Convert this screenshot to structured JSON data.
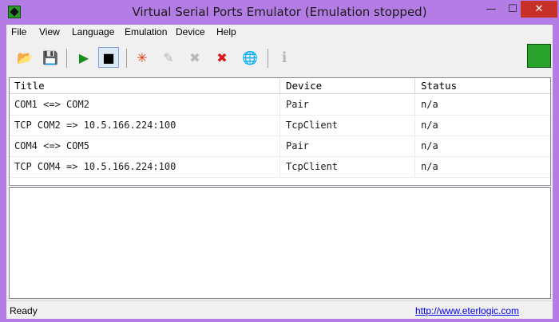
{
  "window": {
    "title": "Virtual Serial Ports Emulator (Emulation stopped)",
    "min_glyph": "—",
    "max_glyph": "☐",
    "close_glyph": "✕"
  },
  "menu": {
    "file": "File",
    "view": "View",
    "language": "Language",
    "emulation": "Emulation",
    "device": "Device",
    "help": "Help"
  },
  "toolbar": {
    "open_glyph": "📂",
    "save_glyph": "💾",
    "start_glyph": "▶",
    "stop_glyph": "■",
    "create_glyph": "✳",
    "edit_glyph": "✎",
    "disconnect_glyph": "✖",
    "delete_glyph": "✖",
    "network_glyph": "🌐",
    "info_glyph": "ℹ"
  },
  "table": {
    "columns": [
      "Title",
      "Device",
      "Status"
    ],
    "rows": [
      {
        "title": "COM1 <=> COM2",
        "device": "Pair",
        "status": "n/a"
      },
      {
        "title": "TCP COM2 => 10.5.166.224:100",
        "device": "TcpClient",
        "status": "n/a"
      },
      {
        "title": "COM4 <=> COM5",
        "device": "Pair",
        "status": "n/a"
      },
      {
        "title": "TCP COM4 => 10.5.166.224:100",
        "device": "TcpClient",
        "status": "n/a"
      }
    ]
  },
  "statusbar": {
    "text": "Ready",
    "link": "http://www.eterlogic.com"
  },
  "colors": {
    "titlebar": "#b47de6",
    "close_button": "#c7312a",
    "start_green": "#1a8d1a"
  }
}
